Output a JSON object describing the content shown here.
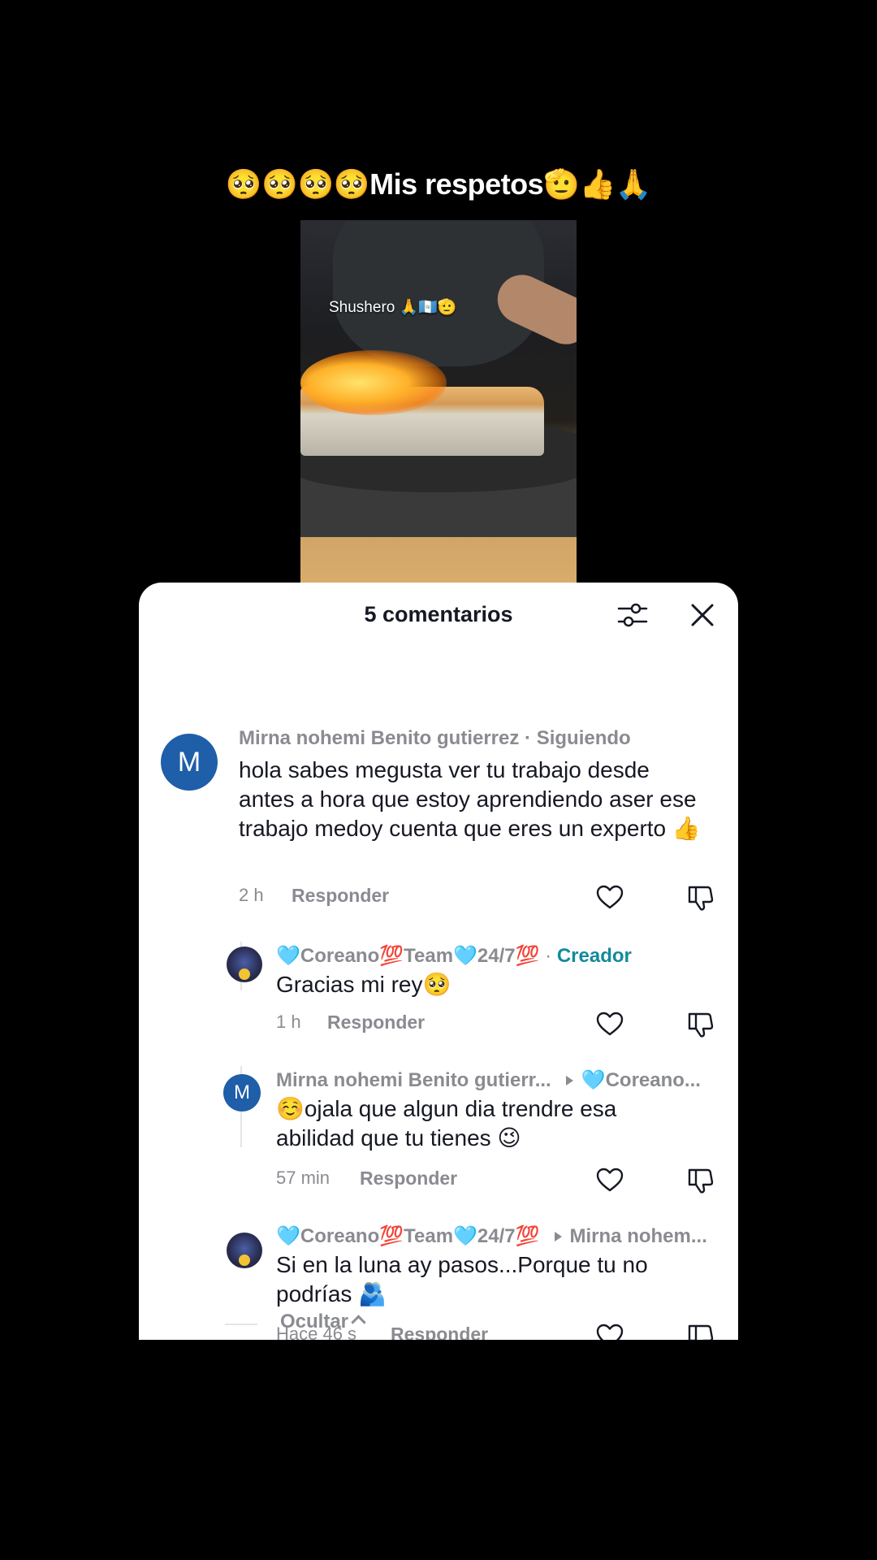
{
  "caption": "🥺🥺🥺🥺Mis respetos🫡👍🙏",
  "video": {
    "overlay_label": "Shushero 🙏🇬🇹🫡"
  },
  "sheet": {
    "title": "5 comentarios",
    "filter_icon": "sliders-icon",
    "close_icon": "close-icon"
  },
  "comments": [
    {
      "avatar_letter": "M",
      "author": "Mirna nohemi Benito gutierrez",
      "suffix": " · Siguiendo",
      "text": "hola sabes megusta ver tu trabajo desde antes a hora que estoy aprendiendo aser ese trabajo medoy cuenta que eres un experto 👍",
      "time": "2 h",
      "reply_label": "Responder"
    },
    {
      "author": "🩵Coreano💯Team🩵24/7💯",
      "suffix": " · ",
      "badge": "Creador",
      "text": "Gracias mi rey🥺",
      "time": "1 h",
      "reply_label": "Responder"
    },
    {
      "avatar_letter": "M",
      "author": "Mirna nohemi Benito gutierr...",
      "reply_to": "🩵Coreano...",
      "text": "☺️ojala que algun dia trendre esa abilidad que tu tienes 😉",
      "time": "57 min",
      "reply_label": "Responder"
    },
    {
      "author": "🩵Coreano💯Team🩵24/7💯",
      "reply_to": "Mirna nohem...",
      "text": "Si en la luna ay pasos...Porque tu no podrías 🫂",
      "time": "Hace 46 s",
      "reply_label": "Responder"
    }
  ],
  "hide_label": "Ocultar",
  "colors": {
    "accent_creator": "#138a9c",
    "avatar_blue": "#1f5ea8",
    "muted": "#8a8b91"
  }
}
